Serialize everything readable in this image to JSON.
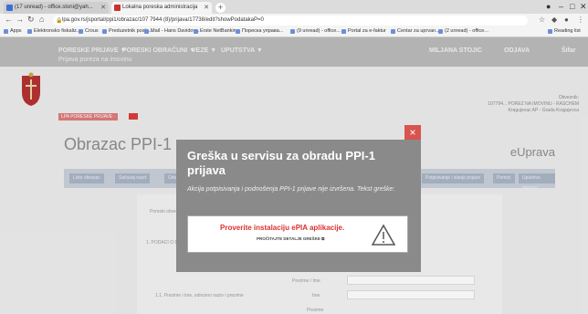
{
  "browser": {
    "tabs": [
      {
        "label": "(17 unread) - office.stoni@yah..."
      },
      {
        "label": "Lokalna poreska administracija"
      }
    ],
    "url": "lpa.gov.rs/jsportal/ppi1/obrazac/107 7944 (8)/prijava/17738/edit?showPodatakaP=0",
    "bookmarks": [
      {
        "label": "Apps"
      },
      {
        "label": "Elektronsko fiskaliz..."
      },
      {
        "label": "Crous"
      },
      {
        "label": "Preduzetnik poslo..."
      },
      {
        "label": "Mail - Hans Davidov..."
      },
      {
        "label": "Erste NetBanking"
      },
      {
        "label": "Пореска управа..."
      },
      {
        "label": "(9 unread) - office..."
      },
      {
        "label": "Portal za e-faktur"
      },
      {
        "label": "Centar za uprvan..."
      },
      {
        "label": "(2 unread) - office..."
      },
      {
        "label": "Reading list"
      }
    ]
  },
  "nav": {
    "items": [
      "PORESKE PRIJAVE ▼",
      "PORESKI OBRAČUNI ▼",
      "VEZE ▼",
      "UPUTSTVA ▼"
    ],
    "subtitle": "Prijava poreza na imovinu",
    "right_1": "MILJANA STOJIC",
    "right_2": "ODJAVA",
    "right_3": "Šifar"
  },
  "user_info": {
    "line1": "Obveznik:",
    "line2": "107794... POREZ NA IMOVINU - RASCHEM",
    "line3": "Kragujevac AP - Grada Kragujevca"
  },
  "breadcrumb": "LPA PORESKE PRIJAVE ·",
  "form": {
    "title": "Obrazac PPI-1",
    "brand": "eUprava",
    "toolbar_buttons": [
      "Listo obrazac",
      "Sačuvaj nacrt",
      "Odustani",
      "Potpisivanje i slanje prijave",
      "Pomoć",
      "Uputstvo obrazac"
    ],
    "fields": [
      {
        "label": "Poreski obveznik"
      },
      {
        "label": "1. PODACI O PORESKOM OBVEZNIKU"
      },
      {
        "label": "Prezime / Ime"
      },
      {
        "label": "1.1. Prezime i ime, odnosno naziv i prezime"
      },
      {
        "label": "Ime"
      },
      {
        "label": "Prezime"
      }
    ]
  },
  "dialog": {
    "close_label": "×",
    "title": "Greška u servisu za obradu PPI-1 prijava",
    "message": "Akcija potpisivanja i podnošenja PPI-1 prijave nije izvršena. Tekst greške:",
    "error_text": "Proverite instalaciju ePIA aplikacije.",
    "details_link": "PROČITAJTE DETALJE GREŠKE",
    "icon": "warning-icon"
  },
  "colors": {
    "dialog_bg": "#8a8a8a",
    "close_bg": "#d9534f",
    "error_red": "#d9322e"
  }
}
